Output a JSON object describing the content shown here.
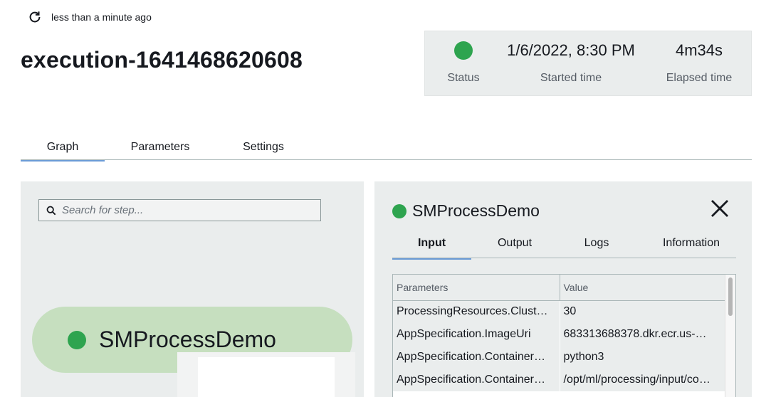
{
  "header": {
    "refresh_text": "less than a minute ago",
    "refresh_icon": "refresh-icon",
    "title": "execution-1641468620608"
  },
  "status": {
    "status_label": "Status",
    "status_color": "#2ea44f",
    "started_value": "1/6/2022, 8:30 PM",
    "started_label": "Started time",
    "elapsed_value": "4m34s",
    "elapsed_label": "Elapsed time"
  },
  "tabs": [
    {
      "label": "Graph",
      "active": true
    },
    {
      "label": "Parameters",
      "active": false
    },
    {
      "label": "Settings",
      "active": false
    }
  ],
  "graph": {
    "search_placeholder": "Search for step...",
    "node_name": "SMProcessDemo",
    "node_status_color": "#2ea44f"
  },
  "details": {
    "step_name": "SMProcessDemo",
    "sub_tabs": [
      {
        "label": "Input",
        "active": true
      },
      {
        "label": "Output",
        "active": false
      },
      {
        "label": "Logs",
        "active": false
      },
      {
        "label": "Information",
        "active": false
      }
    ],
    "table": {
      "headers": [
        "Parameters",
        "Value"
      ],
      "rows": [
        [
          "ProcessingResources.Clust…",
          "30"
        ],
        [
          "AppSpecification.ImageUri",
          "683313688378.dkr.ecr.us-…"
        ],
        [
          "AppSpecification.Container…",
          "python3"
        ],
        [
          "AppSpecification.Container…",
          "/opt/ml/processing/input/co…"
        ]
      ]
    }
  }
}
